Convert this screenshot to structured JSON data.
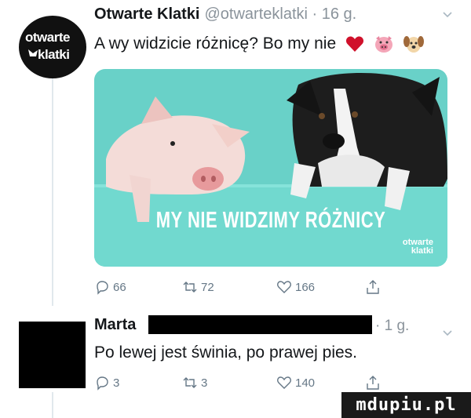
{
  "tweet1": {
    "avatar_text_line1": "otwarte",
    "avatar_text_line2": "klatki",
    "name": "Otwarte Klatki",
    "handle_time": "@otwarteklatki · 16 g.",
    "text": "A wy widzicie różnicę? Bo my nie",
    "media": {
      "caption": "MY NIE WIDZIMY RÓŻNICY",
      "logo_line1": "otwarte",
      "logo_line2": "klatki"
    },
    "actions": {
      "replies": "66",
      "retweets": "72",
      "likes": "166"
    }
  },
  "tweet2": {
    "name": "Marta",
    "time": "· 1 g.",
    "text": "Po lewej jest świnia, po prawej pies.",
    "actions": {
      "replies": "3",
      "retweets": "3",
      "likes": "140"
    }
  },
  "watermark": "mdupiu.pl"
}
